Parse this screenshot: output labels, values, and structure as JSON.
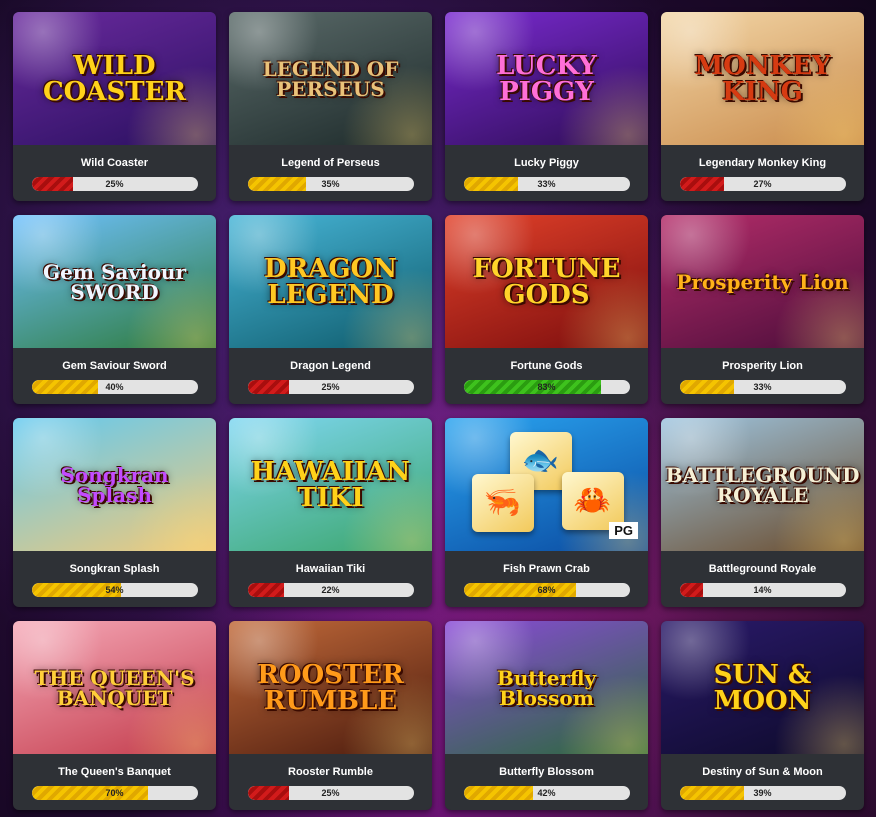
{
  "games": [
    {
      "title": "Wild Coaster",
      "percent_label": "25%",
      "percent": 25,
      "level": "red",
      "logo": "WILD COASTER",
      "bg": [
        "#6a2a9e",
        "#2a1060"
      ],
      "logo_color": "#ffd21a"
    },
    {
      "title": "Legend of Perseus",
      "percent_label": "35%",
      "percent": 35,
      "level": "yellow",
      "logo": "LEGEND OF PERSEUS",
      "bg": [
        "#5b6b6a",
        "#1d2a2a"
      ],
      "logo_color": "#e9c27a"
    },
    {
      "title": "Lucky Piggy",
      "percent_label": "33%",
      "percent": 33,
      "level": "yellow",
      "logo": "LUCKY PIGGY",
      "bg": [
        "#7a2ad0",
        "#2d0d55"
      ],
      "logo_color": "#ff6fd8"
    },
    {
      "title": "Legendary Monkey King",
      "percent_label": "27%",
      "percent": 27,
      "level": "red",
      "logo": "MONKEY KING",
      "bg": [
        "#f3d7a8",
        "#c98a4a"
      ],
      "logo_color": "#d63b12"
    },
    {
      "title": "Gem Saviour Sword",
      "percent_label": "40%",
      "percent": 40,
      "level": "yellow",
      "logo": "Gem Saviour SWORD",
      "bg": [
        "#6fc1ff",
        "#2d7a3a"
      ],
      "logo_color": "#f2f6ff"
    },
    {
      "title": "Dragon Legend",
      "percent_label": "25%",
      "percent": 25,
      "level": "red",
      "logo": "DRAGON LEGEND",
      "bg": [
        "#48b6d8",
        "#0e5a6a"
      ],
      "logo_color": "#ffc823"
    },
    {
      "title": "Fortune Gods",
      "percent_label": "83%",
      "percent": 83,
      "level": "green",
      "logo": "FORTUNE GODS",
      "bg": [
        "#e2412a",
        "#7a0d0d"
      ],
      "logo_color": "#ffd42a"
    },
    {
      "title": "Prosperity Lion",
      "percent_label": "33%",
      "percent": 33,
      "level": "yellow",
      "logo": "Prosperity Lion",
      "bg": [
        "#b52d6a",
        "#4a0d3a"
      ],
      "logo_color": "#ffb21a"
    },
    {
      "title": "Songkran Splash",
      "percent_label": "54%",
      "percent": 54,
      "level": "yellow",
      "logo": "Songkran Splash",
      "bg": [
        "#63c9f0",
        "#f0c97a"
      ],
      "logo_color": "#c34bff"
    },
    {
      "title": "Hawaiian Tiki",
      "percent_label": "22%",
      "percent": 22,
      "level": "red",
      "logo": "HAWAIIAN TIKI",
      "bg": [
        "#7fd7f2",
        "#3aa56a"
      ],
      "logo_color": "#ffd21a"
    },
    {
      "title": "Fish Prawn Crab",
      "percent_label": "68%",
      "percent": 68,
      "level": "yellow",
      "logo": "",
      "bg": [
        "#2aa4f0",
        "#0a4aa0"
      ],
      "logo_color": "#ffffff",
      "badge": "PG"
    },
    {
      "title": "Battleground Royale",
      "percent_label": "14%",
      "percent": 14,
      "level": "red",
      "logo": "BATTLEGROUND ROYALE",
      "bg": [
        "#9ec5e0",
        "#6a4a2a"
      ],
      "logo_color": "#f6f0d6"
    },
    {
      "title": "The Queen's Banquet",
      "percent_label": "70%",
      "percent": 70,
      "level": "yellow",
      "logo": "THE QUEEN'S BANQUET",
      "bg": [
        "#f6a9b8",
        "#c23a4a"
      ],
      "logo_color": "#ffcf3a"
    },
    {
      "title": "Rooster Rumble",
      "percent_label": "25%",
      "percent": 25,
      "level": "red",
      "logo": "ROOSTER RUMBLE",
      "bg": [
        "#c26a3a",
        "#4a1a0d"
      ],
      "logo_color": "#ff9a1a"
    },
    {
      "title": "Butterfly Blossom",
      "percent_label": "42%",
      "percent": 42,
      "level": "yellow",
      "logo": "Butterfly Blossom",
      "bg": [
        "#8a4ad8",
        "#2a6a3a"
      ],
      "logo_color": "#ffd21a"
    },
    {
      "title": "Destiny of Sun & Moon",
      "percent_label": "39%",
      "percent": 39,
      "level": "yellow",
      "logo": "SUN & MOON",
      "bg": [
        "#2a1a6a",
        "#0d0a2a"
      ],
      "logo_color": "#ffd21a"
    }
  ]
}
